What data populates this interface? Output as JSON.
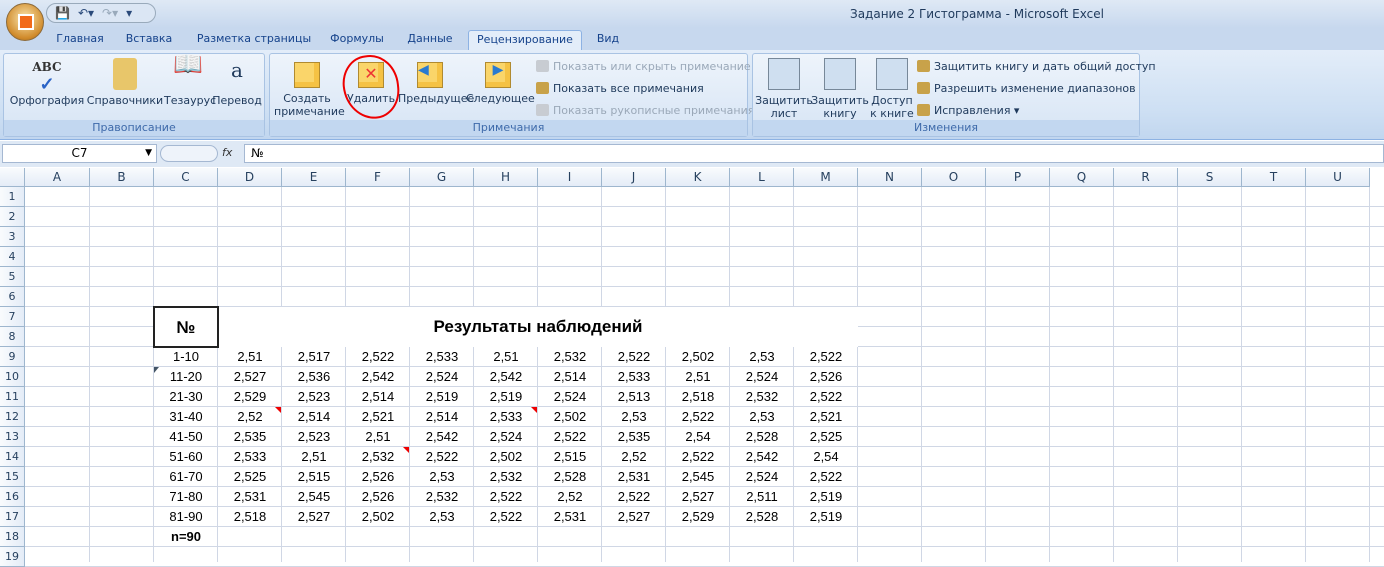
{
  "window": {
    "title": "Задание 2 Гистограмма - Microsoft Excel"
  },
  "ribbon": {
    "tabs": [
      "Главная",
      "Вставка",
      "Разметка страницы",
      "Формулы",
      "Данные",
      "Рецензирование",
      "Вид"
    ],
    "active_tab": "Рецензирование",
    "groups": {
      "spelling": {
        "label": "Правописание",
        "buttons": [
          "Орфография",
          "Справочники",
          "Тезаурус",
          "Перевод"
        ]
      },
      "comments": {
        "label": "Примечания",
        "create": "Создать примечание",
        "create_l1": "Создать",
        "create_l2": "примечание",
        "delete": "Удалить",
        "prev": "Предыдущее",
        "next": "Следующее",
        "show_hide": "Показать или скрыть примечание",
        "show_all": "Показать все примечания",
        "show_ink": "Показать рукописные примечания"
      },
      "changes": {
        "label": "Изменения",
        "protect_sheet_l1": "Защитить",
        "protect_sheet_l2": "лист",
        "protect_book_l1": "Защитить",
        "protect_book_l2": "книгу",
        "access_l1": "Доступ",
        "access_l2": "к книге",
        "protect_share": "Защитить книгу и дать общий доступ",
        "allow_ranges": "Разрешить изменение диапазонов",
        "track": "Исправления"
      }
    }
  },
  "formula_bar": {
    "name_box": "C7",
    "fx": "fx",
    "value": "№"
  },
  "sheet": {
    "columns": [
      "A",
      "B",
      "C",
      "D",
      "E",
      "F",
      "G",
      "H",
      "I",
      "J",
      "K",
      "L",
      "M",
      "N",
      "O",
      "P",
      "Q",
      "R",
      "S",
      "T",
      "U"
    ],
    "rows": [
      "1",
      "2",
      "3",
      "4",
      "5",
      "6",
      "7",
      "8",
      "9",
      "10",
      "11",
      "12",
      "13",
      "14",
      "15",
      "16",
      "17",
      "18",
      "19"
    ],
    "header_num": "№",
    "header_title": "Результаты наблюдений",
    "total": "n=90",
    "data": [
      {
        "range": "1-10",
        "values": [
          "2,51",
          "2,517",
          "2,522",
          "2,533",
          "2,51",
          "2,532",
          "2,522",
          "2,502",
          "2,53",
          "2,522"
        ]
      },
      {
        "range": "11-20",
        "values": [
          "2,527",
          "2,536",
          "2,542",
          "2,524",
          "2,542",
          "2,514",
          "2,533",
          "2,51",
          "2,524",
          "2,526"
        ]
      },
      {
        "range": "21-30",
        "values": [
          "2,529",
          "2,523",
          "2,514",
          "2,519",
          "2,519",
          "2,524",
          "2,513",
          "2,518",
          "2,532",
          "2,522"
        ]
      },
      {
        "range": "31-40",
        "values": [
          "2,52",
          "2,514",
          "2,521",
          "2,514",
          "2,533",
          "2,502",
          "2,53",
          "2,522",
          "2,53",
          "2,521"
        ]
      },
      {
        "range": "41-50",
        "values": [
          "2,535",
          "2,523",
          "2,51",
          "2,542",
          "2,524",
          "2,522",
          "2,535",
          "2,54",
          "2,528",
          "2,525"
        ]
      },
      {
        "range": "51-60",
        "values": [
          "2,533",
          "2,51",
          "2,532",
          "2,522",
          "2,502",
          "2,515",
          "2,52",
          "2,522",
          "2,542",
          "2,54"
        ]
      },
      {
        "range": "61-70",
        "values": [
          "2,525",
          "2,515",
          "2,526",
          "2,53",
          "2,532",
          "2,528",
          "2,531",
          "2,545",
          "2,524",
          "2,522"
        ]
      },
      {
        "range": "71-80",
        "values": [
          "2,531",
          "2,545",
          "2,526",
          "2,532",
          "2,522",
          "2,52",
          "2,522",
          "2,527",
          "2,511",
          "2,519"
        ]
      },
      {
        "range": "81-90",
        "values": [
          "2,518",
          "2,527",
          "2,502",
          "2,53",
          "2,522",
          "2,531",
          "2,527",
          "2,529",
          "2,528",
          "2,519"
        ]
      }
    ]
  }
}
